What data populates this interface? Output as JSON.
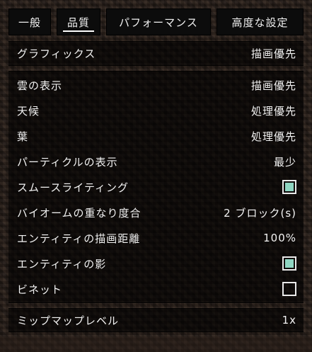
{
  "tabs": [
    {
      "label": "一般",
      "active": false
    },
    {
      "label": "品質",
      "active": true
    },
    {
      "label": "パフォーマンス",
      "active": false
    },
    {
      "label": "高度な設定",
      "active": false
    }
  ],
  "graphics": {
    "label": "グラフィックス",
    "value": "描画優先"
  },
  "settings": [
    {
      "label": "雲の表示",
      "value": "描画優先"
    },
    {
      "label": "天候",
      "value": "処理優先"
    },
    {
      "label": "葉",
      "value": "処理優先"
    },
    {
      "label": "パーティクルの表示",
      "value": "最少"
    },
    {
      "label": "スムースライティング",
      "checked": true
    },
    {
      "label": "バイオームの重なり度合",
      "value": "2 ブロック(s)"
    },
    {
      "label": "エンティティの描画距離",
      "value": "100%"
    },
    {
      "label": "エンティティの影",
      "checked": true
    },
    {
      "label": "ビネット",
      "checked": false
    }
  ],
  "mipmap": {
    "label": "ミップマップレベル",
    "value": "1x"
  },
  "colors": {
    "checkbox_fill": "#8fd6c2",
    "panel_bg": "#000000",
    "text": "#ffffff"
  }
}
